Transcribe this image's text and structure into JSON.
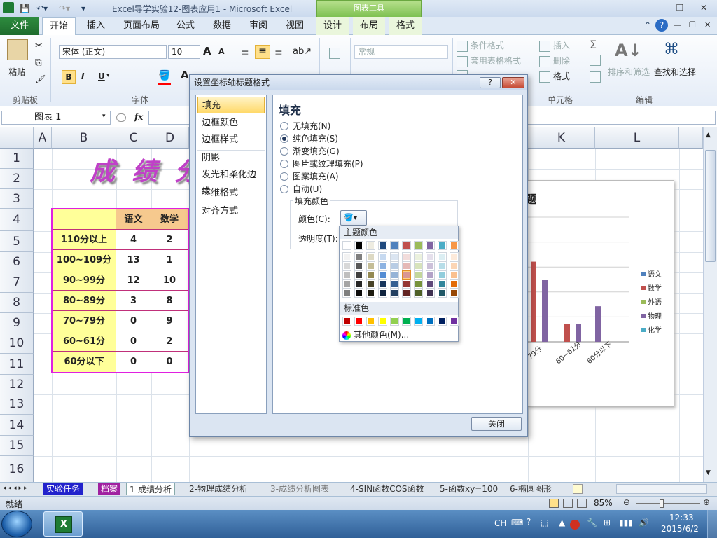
{
  "window": {
    "title": "Excel导学实验12-图表应用1 - Microsoft Excel",
    "chart_tools_label": "图表工具"
  },
  "ribbon_tabs": [
    "文件",
    "开始",
    "插入",
    "页面布局",
    "公式",
    "数据",
    "审阅",
    "视图",
    "设计",
    "布局",
    "格式"
  ],
  "ribbon": {
    "clipboard": {
      "paste": "粘贴",
      "group": "剪贴板"
    },
    "font": {
      "name": "宋体 (正文)",
      "size": "10",
      "bold": "B",
      "italic": "I",
      "underline": "U",
      "grow": "A",
      "shrink": "A",
      "group": "字体"
    },
    "number": {
      "format": "常规"
    },
    "styles": {
      "conditional": "条件格式",
      "table": "套用表格格式"
    },
    "cells": {
      "insert": "插入",
      "delete": "删除",
      "format": "格式",
      "group": "单元格"
    },
    "editing": {
      "sigma": "Σ",
      "sort": "排序和筛选",
      "find": "查找和选择",
      "group": "编辑"
    }
  },
  "formula_bar": {
    "name_box": "图表 1",
    "fx": "fx"
  },
  "columns": [
    "A",
    "B",
    "C",
    "D",
    "K",
    "L"
  ],
  "rows": [
    "1",
    "2",
    "3",
    "4",
    "5",
    "6",
    "7",
    "8",
    "9",
    "10",
    "11",
    "12",
    "13",
    "14",
    "15",
    "16"
  ],
  "sheet": {
    "title_art": "成 绩 分",
    "header": [
      "",
      "语文",
      "数学"
    ],
    "table_rows": [
      {
        "label": "110分以上",
        "a": "4",
        "b": "2"
      },
      {
        "label": "100~109分",
        "a": "13",
        "b": "1"
      },
      {
        "label": "90~99分",
        "a": "12",
        "b": "10"
      },
      {
        "label": "80~89分",
        "a": "3",
        "b": "8"
      },
      {
        "label": "70~79分",
        "a": "0",
        "b": "9"
      },
      {
        "label": "60~61分",
        "a": "0",
        "b": "2"
      },
      {
        "label": "60分以下",
        "a": "0",
        "b": "0"
      }
    ]
  },
  "chart_data": {
    "type": "bar",
    "title": "题",
    "categories": [
      "79分",
      "60~61分",
      "60分以下"
    ],
    "series": [
      {
        "name": "语文",
        "color": "#4f81bd",
        "values": [
          0,
          0,
          0
        ]
      },
      {
        "name": "数学",
        "color": "#c0504d",
        "values": [
          9,
          2,
          0
        ]
      },
      {
        "name": "外语",
        "color": "#9bbb59",
        "values": [
          0,
          0,
          0
        ]
      },
      {
        "name": "物理",
        "color": "#8064a2",
        "values": [
          7,
          2,
          4
        ]
      },
      {
        "name": "化学",
        "color": "#4bacc6",
        "values": [
          0,
          0,
          0
        ]
      }
    ],
    "ylim": [
      0,
      14
    ]
  },
  "dialog": {
    "title": "设置坐标轴标题格式",
    "help": "?",
    "close_x": "✕",
    "nav": [
      "填充",
      "边框颜色",
      "边框样式",
      "阴影",
      "发光和柔化边缘",
      "三维格式",
      "对齐方式"
    ],
    "panel_title": "填充",
    "options": [
      "无填充(N)",
      "纯色填充(S)",
      "渐变填充(G)",
      "图片或纹理填充(P)",
      "图案填充(A)",
      "自动(U)"
    ],
    "selected_option": "纯色填充(S)",
    "fill_color_group": "填充颜色",
    "color_label": "颜色(C):",
    "transparency_label": "透明度(T):",
    "close_button": "关闭"
  },
  "palette": {
    "theme_label": "主题颜色",
    "standard_label": "标准色",
    "more_colors": "其他颜色(M)...",
    "theme_top": [
      "#ffffff",
      "#000000",
      "#eeece1",
      "#1f497d",
      "#4f81bd",
      "#c0504d",
      "#9bbb59",
      "#8064a2",
      "#4bacc6",
      "#f79646"
    ],
    "theme_shades": [
      [
        "#f2f2f2",
        "#7f7f7f",
        "#ddd9c3",
        "#c6d9f0",
        "#dbe5f1",
        "#f2dcdb",
        "#ebf1dd",
        "#e5e0ec",
        "#dbeef3",
        "#fdeada"
      ],
      [
        "#d8d8d8",
        "#595959",
        "#c4bd97",
        "#8db3e2",
        "#b8cce4",
        "#e5b9b7",
        "#d7e3bc",
        "#ccc1d9",
        "#b7dde8",
        "#fbd5b5"
      ],
      [
        "#bfbfbf",
        "#3f3f3f",
        "#938953",
        "#548dd4",
        "#95b3d7",
        "#d99694",
        "#c3d69b",
        "#b2a2c7",
        "#92cddc",
        "#fac08f"
      ],
      [
        "#a5a5a5",
        "#262626",
        "#494429",
        "#17365d",
        "#366092",
        "#953734",
        "#76923c",
        "#5f497a",
        "#31859b",
        "#e36c09"
      ],
      [
        "#7f7f7f",
        "#0c0c0c",
        "#1d1b10",
        "#0f243e",
        "#244061",
        "#632423",
        "#4f6128",
        "#3f3151",
        "#205867",
        "#974806"
      ]
    ],
    "standard": [
      "#c00000",
      "#ff0000",
      "#ffc000",
      "#ffff00",
      "#92d050",
      "#00b050",
      "#00b0f0",
      "#0070c0",
      "#002060",
      "#7030a0"
    ]
  },
  "sheet_tabs": [
    "实验任务",
    "档案",
    "1-成绩分析",
    "2-物理成绩分析",
    "3-成绩分析图表",
    "4-SIN函数COS函数",
    "5-函数xy=100",
    "6-椭圆图形"
  ],
  "status": {
    "ready": "就绪",
    "zoom": "85%"
  },
  "taskbar": {
    "ime": "CH",
    "time": "12:33",
    "date": "2015/6/2"
  }
}
